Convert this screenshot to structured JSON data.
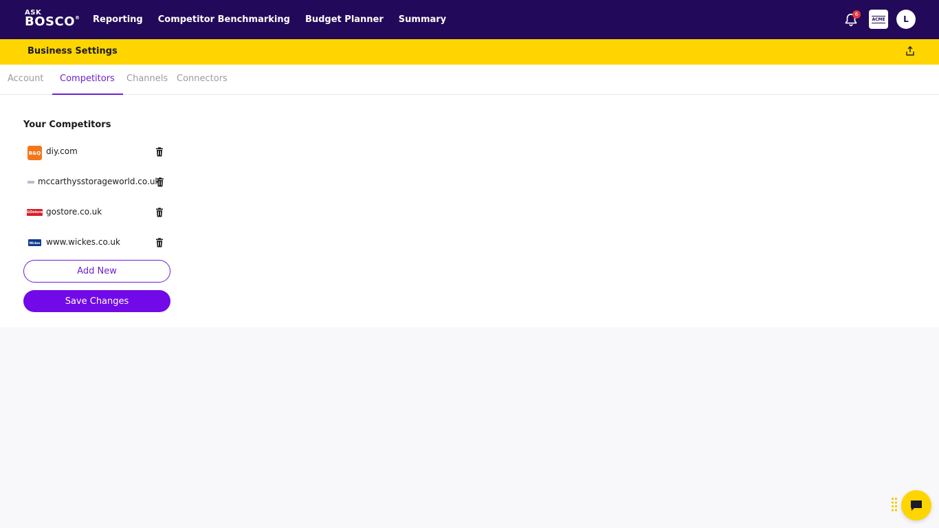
{
  "brand": {
    "ask": "ASK",
    "bosco": "BOSCO",
    "reg": "®"
  },
  "nav": [
    {
      "label": "Reporting"
    },
    {
      "label": "Competitor Benchmarking"
    },
    {
      "label": "Budget Planner"
    },
    {
      "label": "Summary"
    }
  ],
  "header": {
    "notification_count": "6",
    "org_logo_text": "ACME",
    "user_initial": "L"
  },
  "settings": {
    "title": "Business Settings"
  },
  "tabs": [
    {
      "label": "Account"
    },
    {
      "label": "Competitors"
    },
    {
      "label": "Channels"
    },
    {
      "label": "Connectors"
    }
  ],
  "active_tab": "Competitors",
  "competitors": {
    "section_title": "Your Competitors",
    "items": [
      {
        "name": "diy.com",
        "logo": "B&Q"
      },
      {
        "name": "mccarthysstorageworld.co.uk",
        "logo": ""
      },
      {
        "name": "gostore.co.uk",
        "logo": "GOstore"
      },
      {
        "name": "www.wickes.co.uk",
        "logo": "Wickes"
      }
    ]
  },
  "actions": {
    "add_new": "Add New",
    "save_changes": "Save Changes"
  },
  "colors": {
    "topbar": "#22095a",
    "settings_bar": "#ffd500",
    "accent": "#6c1fd4",
    "primary_button": "#7209e8"
  }
}
